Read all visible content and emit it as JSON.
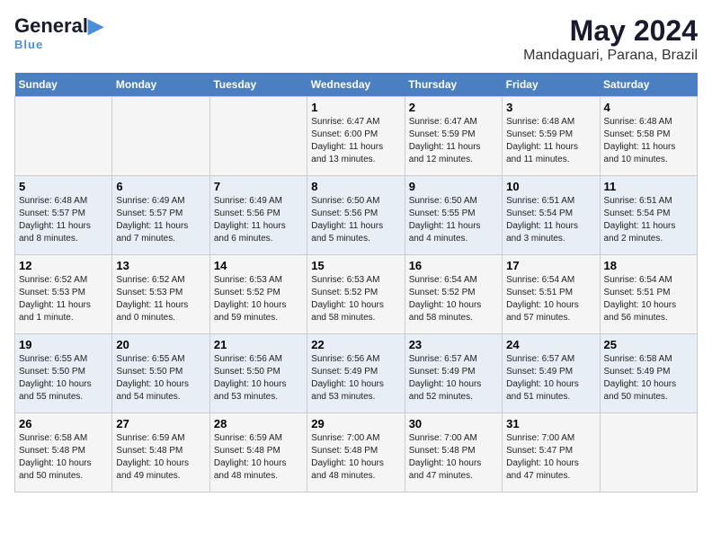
{
  "header": {
    "logo_general": "General",
    "logo_blue": "Blue",
    "main_title": "May 2024",
    "sub_title": "Mandaguari, Parana, Brazil"
  },
  "weekdays": [
    "Sunday",
    "Monday",
    "Tuesday",
    "Wednesday",
    "Thursday",
    "Friday",
    "Saturday"
  ],
  "weeks": [
    [
      {
        "day": "",
        "info": ""
      },
      {
        "day": "",
        "info": ""
      },
      {
        "day": "",
        "info": ""
      },
      {
        "day": "1",
        "info": "Sunrise: 6:47 AM\nSunset: 6:00 PM\nDaylight: 11 hours\nand 13 minutes."
      },
      {
        "day": "2",
        "info": "Sunrise: 6:47 AM\nSunset: 5:59 PM\nDaylight: 11 hours\nand 12 minutes."
      },
      {
        "day": "3",
        "info": "Sunrise: 6:48 AM\nSunset: 5:59 PM\nDaylight: 11 hours\nand 11 minutes."
      },
      {
        "day": "4",
        "info": "Sunrise: 6:48 AM\nSunset: 5:58 PM\nDaylight: 11 hours\nand 10 minutes."
      }
    ],
    [
      {
        "day": "5",
        "info": "Sunrise: 6:48 AM\nSunset: 5:57 PM\nDaylight: 11 hours\nand 8 minutes."
      },
      {
        "day": "6",
        "info": "Sunrise: 6:49 AM\nSunset: 5:57 PM\nDaylight: 11 hours\nand 7 minutes."
      },
      {
        "day": "7",
        "info": "Sunrise: 6:49 AM\nSunset: 5:56 PM\nDaylight: 11 hours\nand 6 minutes."
      },
      {
        "day": "8",
        "info": "Sunrise: 6:50 AM\nSunset: 5:56 PM\nDaylight: 11 hours\nand 5 minutes."
      },
      {
        "day": "9",
        "info": "Sunrise: 6:50 AM\nSunset: 5:55 PM\nDaylight: 11 hours\nand 4 minutes."
      },
      {
        "day": "10",
        "info": "Sunrise: 6:51 AM\nSunset: 5:54 PM\nDaylight: 11 hours\nand 3 minutes."
      },
      {
        "day": "11",
        "info": "Sunrise: 6:51 AM\nSunset: 5:54 PM\nDaylight: 11 hours\nand 2 minutes."
      }
    ],
    [
      {
        "day": "12",
        "info": "Sunrise: 6:52 AM\nSunset: 5:53 PM\nDaylight: 11 hours\nand 1 minute."
      },
      {
        "day": "13",
        "info": "Sunrise: 6:52 AM\nSunset: 5:53 PM\nDaylight: 11 hours\nand 0 minutes."
      },
      {
        "day": "14",
        "info": "Sunrise: 6:53 AM\nSunset: 5:52 PM\nDaylight: 10 hours\nand 59 minutes."
      },
      {
        "day": "15",
        "info": "Sunrise: 6:53 AM\nSunset: 5:52 PM\nDaylight: 10 hours\nand 58 minutes."
      },
      {
        "day": "16",
        "info": "Sunrise: 6:54 AM\nSunset: 5:52 PM\nDaylight: 10 hours\nand 58 minutes."
      },
      {
        "day": "17",
        "info": "Sunrise: 6:54 AM\nSunset: 5:51 PM\nDaylight: 10 hours\nand 57 minutes."
      },
      {
        "day": "18",
        "info": "Sunrise: 6:54 AM\nSunset: 5:51 PM\nDaylight: 10 hours\nand 56 minutes."
      }
    ],
    [
      {
        "day": "19",
        "info": "Sunrise: 6:55 AM\nSunset: 5:50 PM\nDaylight: 10 hours\nand 55 minutes."
      },
      {
        "day": "20",
        "info": "Sunrise: 6:55 AM\nSunset: 5:50 PM\nDaylight: 10 hours\nand 54 minutes."
      },
      {
        "day": "21",
        "info": "Sunrise: 6:56 AM\nSunset: 5:50 PM\nDaylight: 10 hours\nand 53 minutes."
      },
      {
        "day": "22",
        "info": "Sunrise: 6:56 AM\nSunset: 5:49 PM\nDaylight: 10 hours\nand 53 minutes."
      },
      {
        "day": "23",
        "info": "Sunrise: 6:57 AM\nSunset: 5:49 PM\nDaylight: 10 hours\nand 52 minutes."
      },
      {
        "day": "24",
        "info": "Sunrise: 6:57 AM\nSunset: 5:49 PM\nDaylight: 10 hours\nand 51 minutes."
      },
      {
        "day": "25",
        "info": "Sunrise: 6:58 AM\nSunset: 5:49 PM\nDaylight: 10 hours\nand 50 minutes."
      }
    ],
    [
      {
        "day": "26",
        "info": "Sunrise: 6:58 AM\nSunset: 5:48 PM\nDaylight: 10 hours\nand 50 minutes."
      },
      {
        "day": "27",
        "info": "Sunrise: 6:59 AM\nSunset: 5:48 PM\nDaylight: 10 hours\nand 49 minutes."
      },
      {
        "day": "28",
        "info": "Sunrise: 6:59 AM\nSunset: 5:48 PM\nDaylight: 10 hours\nand 48 minutes."
      },
      {
        "day": "29",
        "info": "Sunrise: 7:00 AM\nSunset: 5:48 PM\nDaylight: 10 hours\nand 48 minutes."
      },
      {
        "day": "30",
        "info": "Sunrise: 7:00 AM\nSunset: 5:48 PM\nDaylight: 10 hours\nand 47 minutes."
      },
      {
        "day": "31",
        "info": "Sunrise: 7:00 AM\nSunset: 5:47 PM\nDaylight: 10 hours\nand 47 minutes."
      },
      {
        "day": "",
        "info": ""
      }
    ]
  ]
}
